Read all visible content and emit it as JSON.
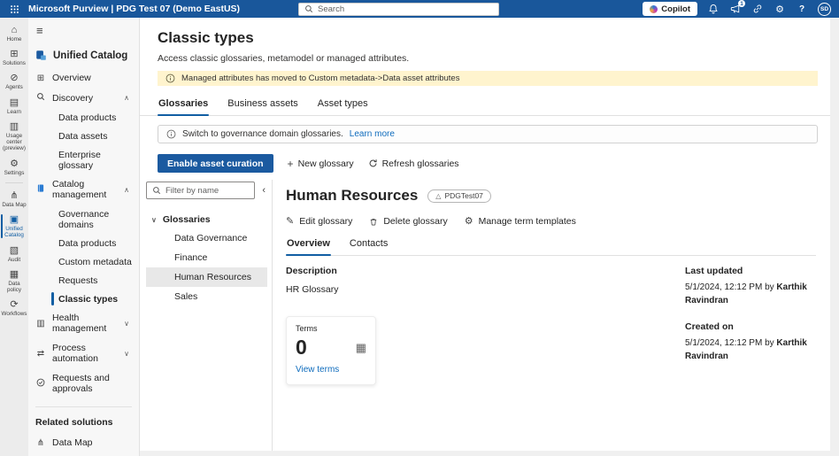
{
  "colors": {
    "topbar_bg": "#19579B",
    "primary": "#1B5AA0",
    "link": "#0F6CBD",
    "accent": "#115EA3",
    "warning_bg": "#FFF4CE",
    "rail_bg": "#ECECEC",
    "sidebar_bg": "#F7F7F7",
    "selected_bg": "#E8E8E8",
    "page_bg": "#F0F0F0"
  },
  "topbar": {
    "title": "Microsoft Purview | PDG Test 07 (Demo EastUS)",
    "search_placeholder": "Search",
    "copilot_label": "Copilot",
    "notification_badge": "1",
    "avatar_initials": "SD",
    "icons": [
      "waffle-menu",
      "search",
      "copilot",
      "bell",
      "megaphone",
      "link",
      "gear",
      "help",
      "avatar"
    ]
  },
  "rail": {
    "items": [
      {
        "label": "Home",
        "icon": "home"
      },
      {
        "label": "Solutions",
        "icon": "solutions-grid"
      },
      {
        "label": "Agents",
        "icon": "agents"
      },
      {
        "label": "Learn",
        "icon": "book"
      },
      {
        "label": "Usage center (preview)",
        "icon": "usage-chart"
      },
      {
        "label": "Settings",
        "icon": "gear"
      },
      {
        "label": "Data Map",
        "icon": "data-map"
      },
      {
        "label": "Unified Catalog",
        "icon": "unified-catalog"
      },
      {
        "label": "Audit",
        "icon": "audit"
      },
      {
        "label": "Data policy",
        "icon": "data-policy"
      },
      {
        "label": "Workflows",
        "icon": "workflows"
      }
    ]
  },
  "sidebar": {
    "title": "Unified Catalog",
    "overview": "Overview",
    "discovery": {
      "label": "Discovery",
      "children": [
        "Data products",
        "Data assets",
        "Enterprise glossary"
      ]
    },
    "catalog_management": {
      "label": "Catalog management",
      "children": [
        "Governance domains",
        "Data products",
        "Custom metadata",
        "Requests",
        "Classic types"
      ]
    },
    "health": "Health management",
    "process": "Process automation",
    "requests": "Requests and approvals",
    "related_header": "Related solutions",
    "related": [
      "Data Map"
    ]
  },
  "main": {
    "title": "Classic types",
    "subtitle": "Access classic glossaries, metamodel or managed attributes.",
    "warning": "Managed attributes has moved to Custom metadata->Data asset attributes",
    "tabs": [
      {
        "label": "Glossaries"
      },
      {
        "label": "Business assets"
      },
      {
        "label": "Asset types"
      }
    ],
    "info": {
      "text": "Switch to governance domain glossaries.",
      "link": "Learn more"
    },
    "actions": {
      "enable": "Enable asset curation",
      "new_glossary": "New glossary",
      "refresh": "Refresh glossaries"
    },
    "tree": {
      "filter_placeholder": "Filter by name",
      "root": "Glossaries",
      "items": [
        {
          "label": "Data Governance"
        },
        {
          "label": "Finance"
        },
        {
          "label": "Human Resources"
        },
        {
          "label": "Sales"
        }
      ]
    },
    "detail": {
      "title": "Human Resources",
      "badge": "PDGTest07",
      "commands": [
        {
          "label": "Edit glossary",
          "icon": "pencil"
        },
        {
          "label": "Delete glossary",
          "icon": "trash"
        },
        {
          "label": "Manage term templates",
          "icon": "gear"
        }
      ],
      "tabs": [
        {
          "label": "Overview"
        },
        {
          "label": "Contacts"
        }
      ],
      "description_label": "Description",
      "description": "HR Glossary",
      "terms": {
        "label": "Terms",
        "count": "0",
        "link": "View terms"
      },
      "meta": [
        {
          "label": "Last updated",
          "prefix": "5/1/2024, 12:12 PM by ",
          "name": "Karthik Ravindran"
        },
        {
          "label": "Created on",
          "prefix": "5/1/2024, 12:12 PM by ",
          "name": "Karthik Ravindran"
        }
      ]
    }
  }
}
